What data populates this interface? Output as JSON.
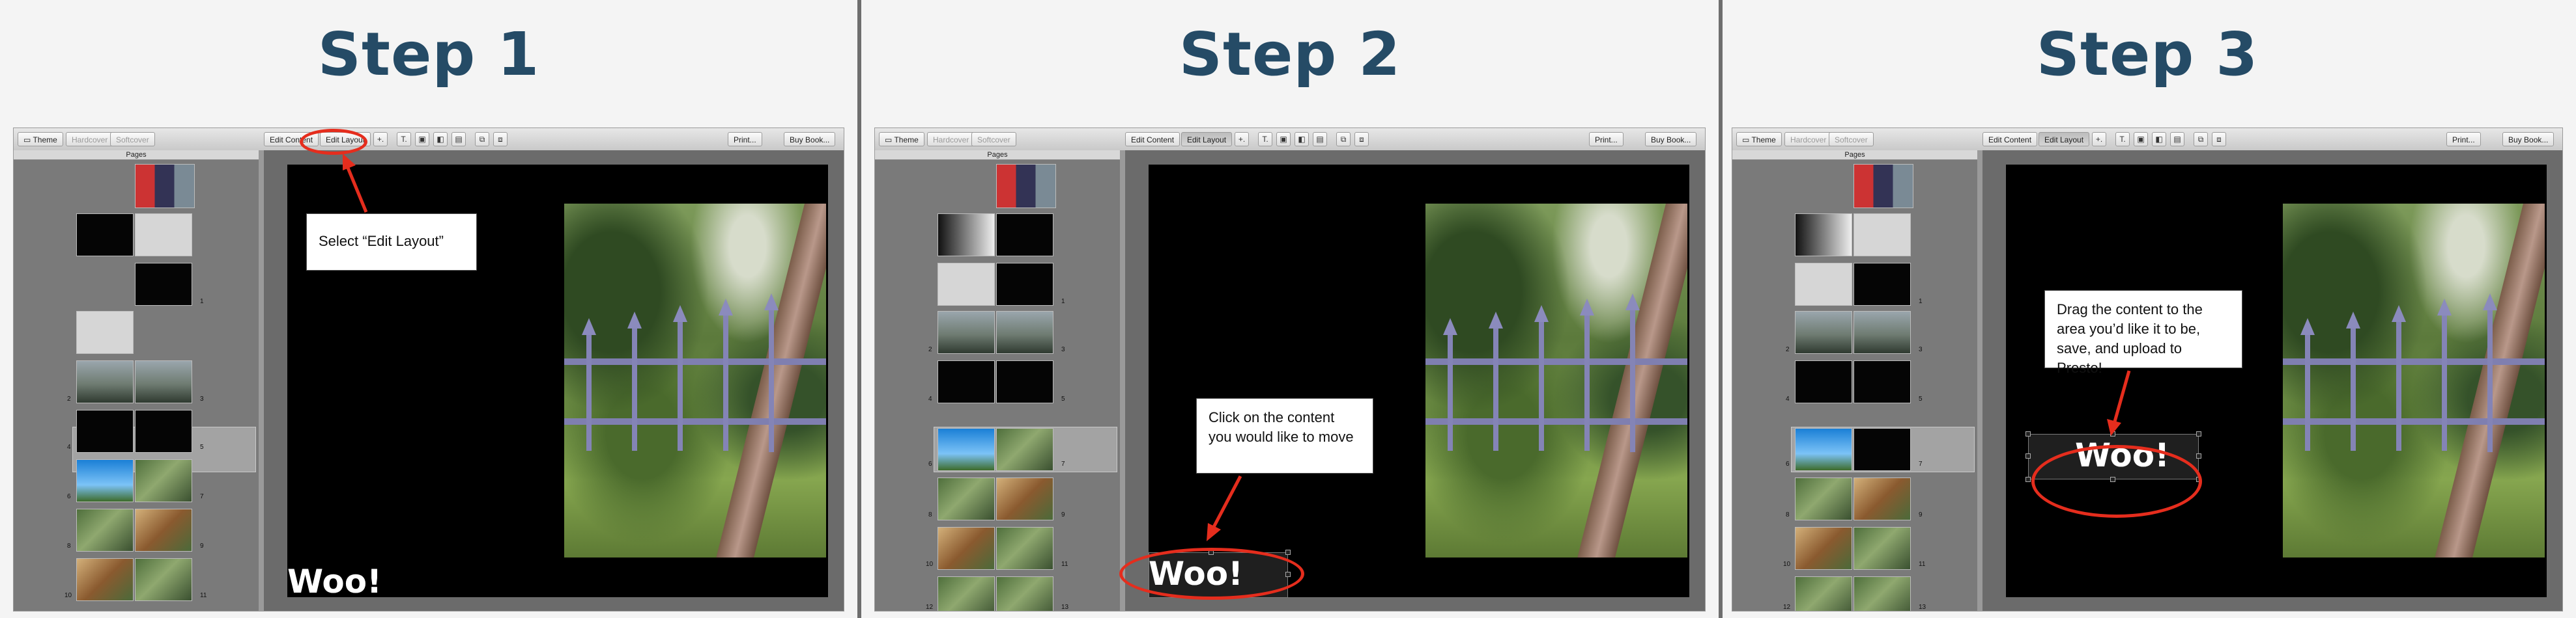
{
  "steps": [
    {
      "title": "Step 1",
      "callout": "Select “Edit Layout”",
      "woo": "Woo!"
    },
    {
      "title": "Step 2",
      "callout_line1": "Click on the content",
      "callout_line2": "you would like to move",
      "woo": "Woo!"
    },
    {
      "title": "Step 3",
      "callout_line1": "Drag the content to the",
      "callout_line2": "area you’d like it to be,",
      "callout_line3": "save, and upload to Presto!",
      "woo": "Woo!"
    }
  ],
  "toolbar": {
    "theme": "Theme",
    "hardcover": "Hardcover",
    "softcover": "Softcover",
    "edit_content": "Edit Content",
    "edit_layout": "Edit Layout",
    "add_tool": "+.",
    "text_tool": "T.",
    "print": "Print...",
    "buy_book": "Buy Book..."
  },
  "pages_header": "Pages",
  "page_numbers": [
    "1",
    "2",
    "3",
    "4",
    "5",
    "6",
    "7",
    "8",
    "9",
    "10",
    "11",
    "12",
    "13"
  ],
  "colors": {
    "title": "#254b66",
    "annotation": "#e52d1d"
  },
  "icons": [
    "grid-icon",
    "text-icon",
    "image-icon",
    "shape-icon",
    "frame-icon",
    "layer-icon"
  ]
}
